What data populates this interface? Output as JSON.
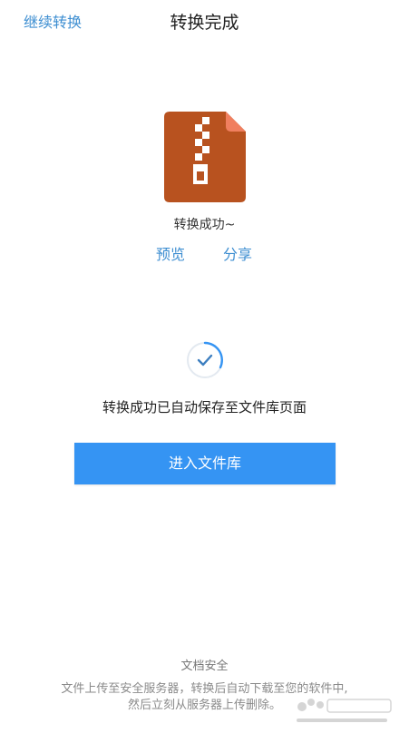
{
  "header": {
    "left_action": "继续转换",
    "title": "转换完成"
  },
  "file": {
    "icon": "zip-file-icon",
    "color": "#b8521f",
    "corner_color": "#f07f5f"
  },
  "result": {
    "success_text": "转换成功~",
    "preview_label": "预览",
    "share_label": "分享"
  },
  "status": {
    "icon": "check-circle-icon",
    "saved_text": "转换成功已自动保存至文件库页面"
  },
  "primary_button": {
    "label": "进入文件库",
    "color": "#3594f3"
  },
  "footer": {
    "title": "文档安全",
    "line1": "文件上传至安全服务器，转换后自动下载至您的软件中,",
    "line2": "然后立刻从服务器上传删除。"
  },
  "accent_color": "#3d8ed1"
}
